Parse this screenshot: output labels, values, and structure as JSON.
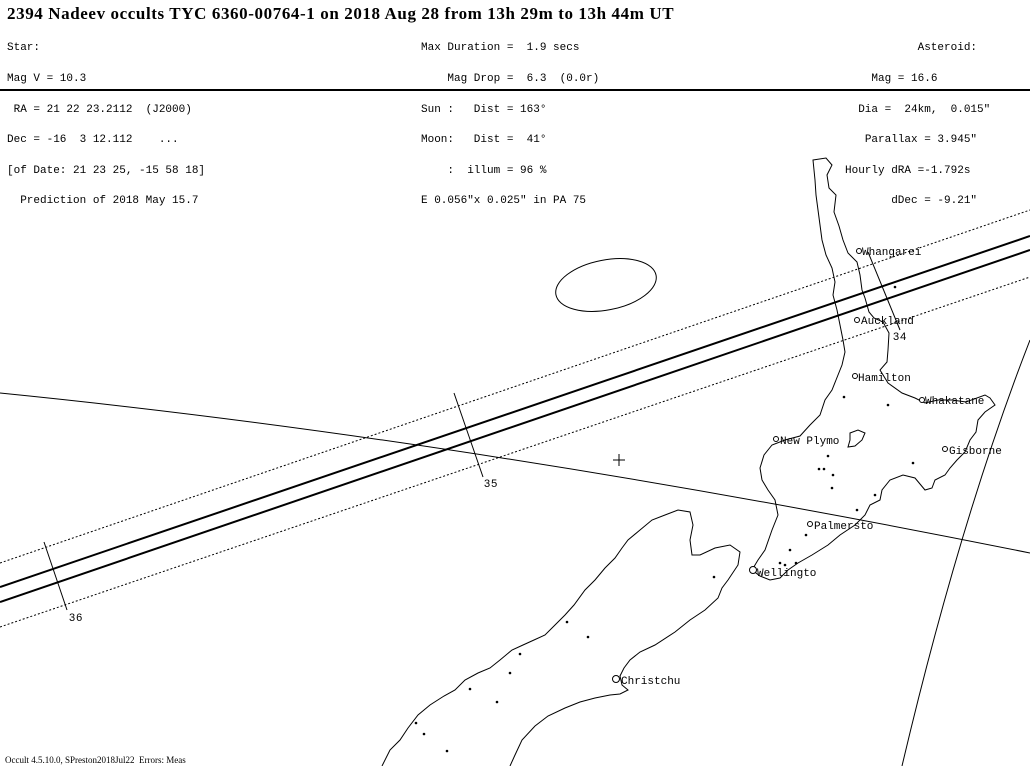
{
  "header": {
    "title": "2394 Nadeev occults TYC 6360-00764-1 on 2018 Aug 28 from 13h 29m to 13h 44m UT",
    "star": [
      "Star:",
      "Mag V = 10.3",
      " RA = 21 22 23.2112  (J2000)",
      "Dec = -16  3 12.112    ...",
      "[of Date: 21 23 25, -15 58 18]",
      "  Prediction of 2018 May 15.7"
    ],
    "event": [
      "Max Duration =  1.9 secs",
      "    Mag Drop =  6.3  (0.0r)",
      "Sun :   Dist = 163°",
      "Moon:   Dist =  41°",
      "    :  illum = 96 %",
      "E 0.056\"x 0.025\" in PA 75"
    ],
    "asteroid": [
      "Asteroid:  ",
      "  Mag = 16.6        ",
      "  Dia =  24km,  0.015\"",
      "Parallax = 3.945\"  ",
      "Hourly dRA =-1.792s   ",
      "dDec = -9.21\"  "
    ]
  },
  "map": {
    "region": "New Zealand",
    "cities": [
      {
        "name": "Whangarei"
      },
      {
        "name": "Auckland"
      },
      {
        "name": "Hamilton"
      },
      {
        "name": "Whakatane"
      },
      {
        "name": "New Plymo"
      },
      {
        "name": "Gisborne"
      },
      {
        "name": "Palmersto"
      },
      {
        "name": "Wellingto"
      },
      {
        "name": "Christchu"
      }
    ],
    "time_ticks": [
      {
        "label": "34"
      },
      {
        "label": "35"
      },
      {
        "label": "36"
      }
    ],
    "path_lines": {
      "center_limits": "solid",
      "error_limits": "dotted"
    },
    "colors": {
      "ink": "#000000",
      "background": "#ffffff"
    }
  },
  "footer": {
    "text": "Occult 4.5.10.0, SPreston2018Jul22  Errors: Meas"
  }
}
